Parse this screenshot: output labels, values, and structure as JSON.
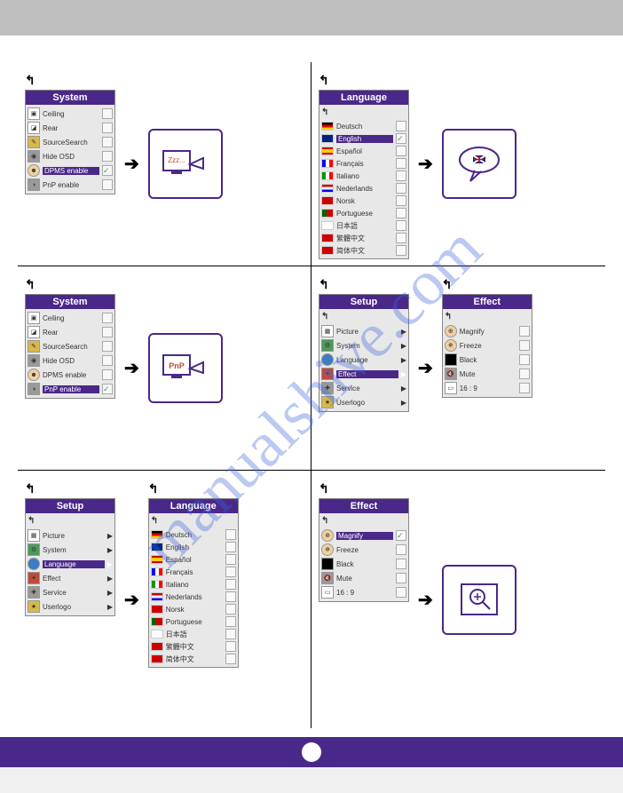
{
  "watermark": "manualshive.com",
  "menus": {
    "system": {
      "title": "System",
      "items": [
        {
          "label": "Ceiling",
          "checked": false
        },
        {
          "label": "Rear",
          "checked": false
        },
        {
          "label": "SourceSearch",
          "checked": false
        },
        {
          "label": "Hide OSD",
          "checked": false
        },
        {
          "label": "DPMS enable",
          "checked": true
        },
        {
          "label": "PnP enable",
          "checked": false
        }
      ]
    },
    "system2": {
      "title": "System",
      "items": [
        {
          "label": "Ceiling",
          "checked": false
        },
        {
          "label": "Rear",
          "checked": false
        },
        {
          "label": "SourceSearch",
          "checked": false
        },
        {
          "label": "Hide OSD",
          "checked": false
        },
        {
          "label": "DPMS enable",
          "checked": false
        },
        {
          "label": "PnP enable",
          "checked": true
        }
      ]
    },
    "language": {
      "title": "Language",
      "items": [
        {
          "label": "Deutsch",
          "flag": "de"
        },
        {
          "label": "English",
          "flag": "en"
        },
        {
          "label": "Español",
          "flag": "es"
        },
        {
          "label": "Français",
          "flag": "fr"
        },
        {
          "label": "Italiano",
          "flag": "it"
        },
        {
          "label": "Nederlands",
          "flag": "nl"
        },
        {
          "label": "Norsk",
          "flag": "no"
        },
        {
          "label": "Portuguese",
          "flag": "pt"
        },
        {
          "label": "日本語",
          "flag": "jp"
        },
        {
          "label": "繁體中文",
          "flag": "cn"
        },
        {
          "label": "简体中文",
          "flag": "cn"
        }
      ]
    },
    "setup": {
      "title": "Setup",
      "items": [
        {
          "label": "Picture"
        },
        {
          "label": "System"
        },
        {
          "label": "Language"
        },
        {
          "label": "Effect"
        },
        {
          "label": "Service"
        },
        {
          "label": "Userlogo"
        }
      ]
    },
    "effect": {
      "title": "Effect",
      "items": [
        {
          "label": "Magnify"
        },
        {
          "label": "Freeze"
        },
        {
          "label": "Black"
        },
        {
          "label": "Mute"
        },
        {
          "label": "16 : 9"
        }
      ]
    }
  },
  "previews": {
    "sleep": "Zzz...",
    "pnp": "PnP"
  }
}
